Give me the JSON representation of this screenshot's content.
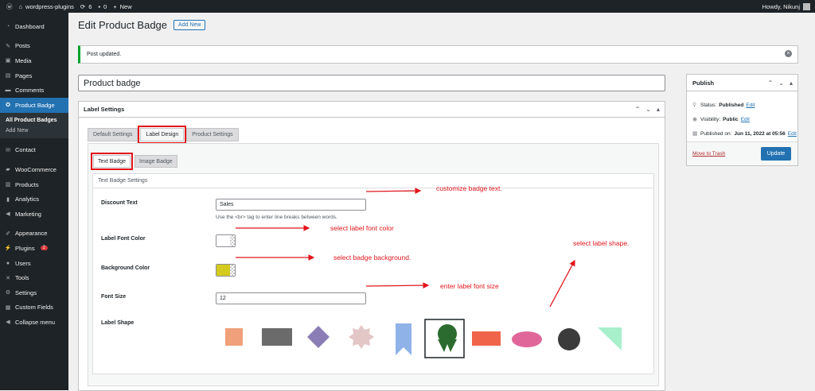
{
  "adminbar": {
    "site": "wordpress-plugins",
    "updates": "6",
    "comments": "0",
    "new": "New",
    "howdy": "Howdy, Nikunj"
  },
  "sidebar": {
    "items": [
      {
        "label": "Dashboard",
        "icon": "dashboard-icon"
      },
      {
        "label": "Posts",
        "icon": "pin-icon"
      },
      {
        "label": "Media",
        "icon": "media-icon"
      },
      {
        "label": "Pages",
        "icon": "page-icon"
      },
      {
        "label": "Comments",
        "icon": "comment-icon"
      },
      {
        "label": "Product Badge",
        "icon": "badge-icon"
      },
      {
        "label": "Contact",
        "icon": "mail-icon"
      },
      {
        "label": "WooCommerce",
        "icon": "woo-icon"
      },
      {
        "label": "Products",
        "icon": "archive-icon"
      },
      {
        "label": "Analytics",
        "icon": "chart-icon"
      },
      {
        "label": "Marketing",
        "icon": "megaphone-icon"
      },
      {
        "label": "Appearance",
        "icon": "brush-icon"
      },
      {
        "label": "Plugins",
        "icon": "plug-icon",
        "count": "2"
      },
      {
        "label": "Users",
        "icon": "user-icon"
      },
      {
        "label": "Tools",
        "icon": "wrench-icon"
      },
      {
        "label": "Settings",
        "icon": "settings-icon"
      },
      {
        "label": "Custom Fields",
        "icon": "grid-icon"
      },
      {
        "label": "Collapse menu",
        "icon": "collapse-icon"
      }
    ],
    "submenu": [
      "All Product Badges",
      "Add New"
    ]
  },
  "page": {
    "title": "Edit Product Badge",
    "add_new": "Add New",
    "notice": "Post updated.",
    "post_title": "Product badge"
  },
  "metabox": {
    "title": "Label Settings",
    "tabs": [
      "Default Settings",
      "Label Design",
      "Product Settings"
    ],
    "subtabs": [
      "Text Badge",
      "Image Badge"
    ],
    "section_title": "Text Badge Settings",
    "fields": {
      "discount_label": "Discount Text",
      "discount_value": "Sales",
      "discount_help": "Use the <br> tag to enter line breaks between words.",
      "font_color_label": "Label Font Color",
      "font_color": "#ffffff",
      "bg_color_label": "Background Color",
      "bg_color": "#d4cb1e",
      "font_size_label": "Font Size",
      "font_size_value": "12",
      "shape_label": "Label Shape"
    }
  },
  "annotations": {
    "text": "customize badge text.",
    "font_color": "select label font color",
    "bg": "select badge background.",
    "font_size": "enter label font size",
    "shape": "select label shape."
  },
  "shapes": [
    {
      "name": "square",
      "color": "#f0a07a"
    },
    {
      "name": "rectangle",
      "color": "#6b6b6b"
    },
    {
      "name": "diamond",
      "color": "#8a7db5"
    },
    {
      "name": "starburst",
      "color": "#e3c6c6"
    },
    {
      "name": "ribbon",
      "color": "#8fb2e8"
    },
    {
      "name": "rosette",
      "color": "#2c6b2f",
      "selected": true
    },
    {
      "name": "wide-rectangle",
      "color": "#f0654a"
    },
    {
      "name": "ellipse",
      "color": "#e06699"
    },
    {
      "name": "circle",
      "color": "#3b3b3b"
    },
    {
      "name": "triangle",
      "color": "#a8efcc"
    }
  ],
  "publish": {
    "title": "Publish",
    "status_label": "Status:",
    "status_value": "Published",
    "visibility_label": "Visibility:",
    "visibility_value": "Public",
    "published_label": "Published on:",
    "published_value": "Jun 11, 2022 at 05:56",
    "edit": "Edit",
    "trash": "Move to Trash",
    "update": "Update"
  }
}
